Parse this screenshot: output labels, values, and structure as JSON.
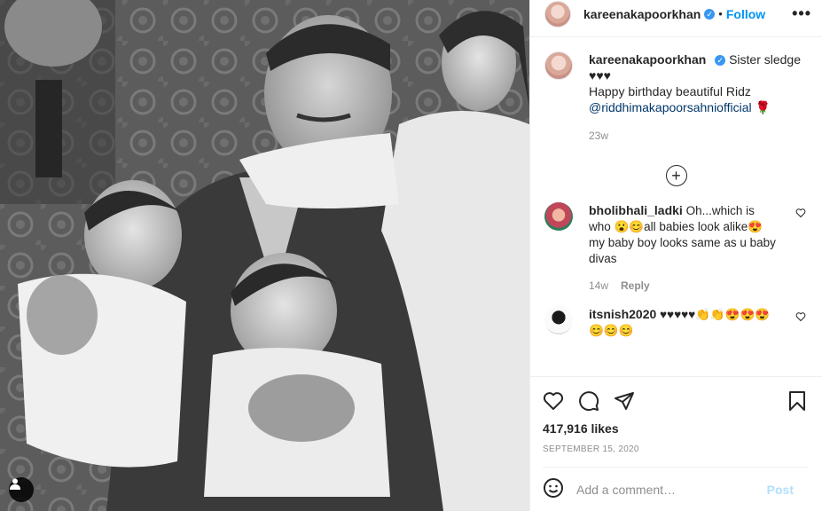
{
  "header": {
    "username": "kareenakapoorkhan",
    "dot": "•",
    "follow_label": "Follow",
    "more_label": "•••"
  },
  "caption": {
    "username": "kareenakapoorkhan",
    "line1": "Sister sledge",
    "line2": "♥♥♥",
    "line3": "Happy birthday beautiful Ridz",
    "mention": "@riddhimakapoorsahniofficial",
    "emoji": "🌹",
    "time": "23w"
  },
  "load_more": "+",
  "comments": [
    {
      "username": "bholibhali_ladki",
      "text": "Oh...which is who 😮😊all babies look alike😍 my baby boy looks same as u baby divas",
      "time": "14w",
      "reply_label": "Reply"
    },
    {
      "username": "itsnish2020",
      "text": "♥♥♥♥♥👏👏😍😍😍😊😊😊",
      "time": "",
      "reply_label": ""
    }
  ],
  "actions": {
    "likes": "417,916 likes",
    "date": "SEPTEMBER 15, 2020"
  },
  "add_comment": {
    "placeholder": "Add a comment…",
    "post_label": "Post"
  },
  "icons": {
    "heart": "heart-icon",
    "comment": "comment-icon",
    "share": "share-icon",
    "bookmark": "bookmark-icon",
    "emoji": "emoji-icon",
    "user_tag": "user-tag-icon"
  },
  "colors": {
    "accent": "#0095f6",
    "verified": "#3897f0",
    "muted": "#8e8e8e",
    "post_disabled": "#b2dffc"
  }
}
